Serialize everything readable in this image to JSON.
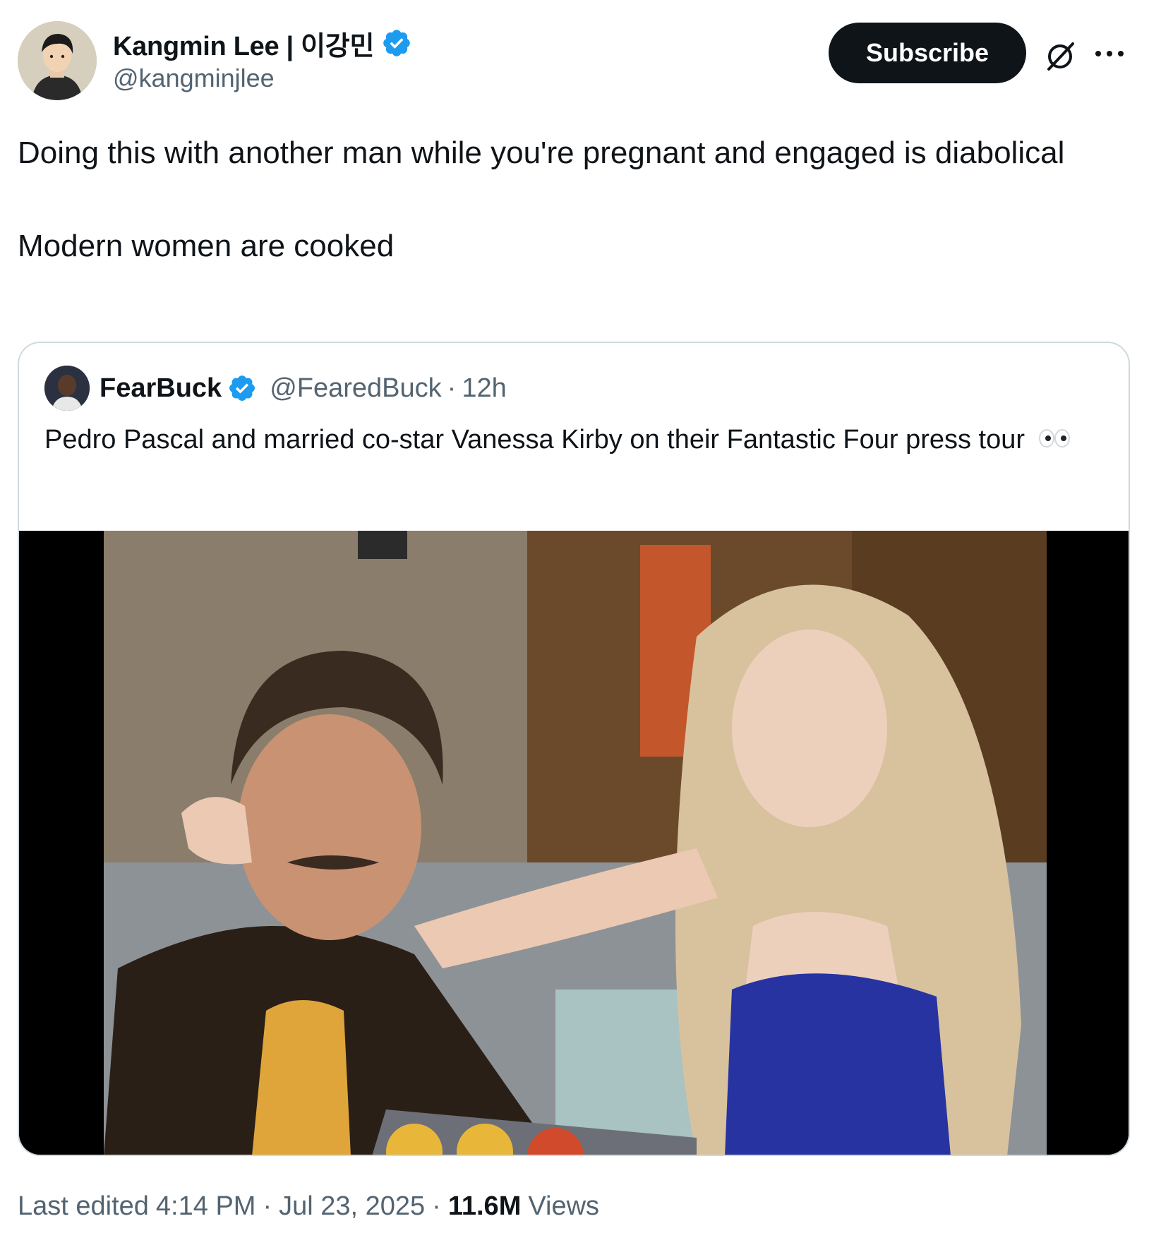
{
  "author": {
    "name": "Kangmin Lee | 이강민",
    "handle": "@kangminjlee"
  },
  "header": {
    "subscribe_label": "Subscribe"
  },
  "tweet": {
    "paragraphs": [
      "Doing this with another man while you're pregnant and engaged is diabolical",
      "Modern women are cooked"
    ]
  },
  "quote": {
    "name": "FearBuck",
    "handle": "@FearedBuck",
    "separator": "·",
    "time": "12h",
    "text": "Pedro Pascal and married co-star Vanessa Kirby on their Fantastic Four press tour"
  },
  "footer": {
    "edited_label": "Last edited",
    "time": "4:14 PM",
    "separator": "·",
    "date": "Jul 23, 2025",
    "views_count": "11.6M",
    "views_label": "Views"
  },
  "colors": {
    "verified": "#1d9bf0",
    "subscribe_bg": "#0f1419",
    "muted_text": "#536471",
    "card_border": "#cfd9de"
  },
  "icons": {
    "verified": "verified-badge-icon",
    "grok": "grok-icon",
    "more": "more-horizontal-icon",
    "eyes": "eyes-emoji-icon"
  }
}
